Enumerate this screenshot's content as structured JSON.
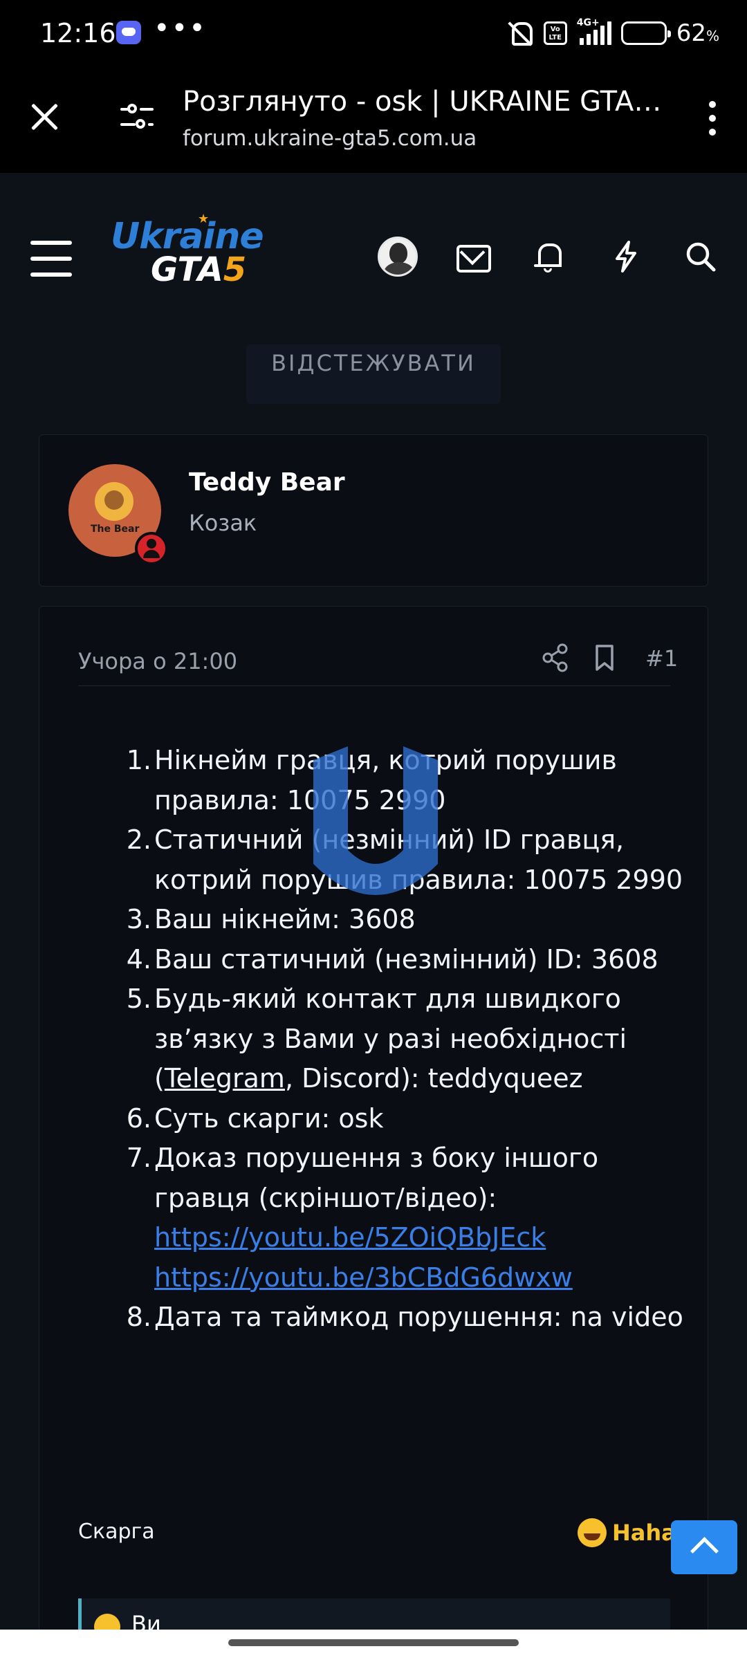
{
  "status_bar": {
    "time": "12:16",
    "overflow": "•••",
    "volte": "Vo\nLTE",
    "network": "4G+",
    "battery_percent": "62",
    "battery_unit": "%",
    "battery_level": 0.62
  },
  "browser": {
    "title": "Розглянуто - osk | UKRAINE GTA 5...",
    "url": "forum.ukraine-gta5.com.ua"
  },
  "site": {
    "logo_line1": "Ukraine",
    "logo_line2": "GTA",
    "logo_five": "5",
    "follow_label": "ВІДСТЕЖУВАТИ"
  },
  "author": {
    "name": "Teddy Bear",
    "rank": "Козак",
    "avatar_text": "The Bear"
  },
  "post": {
    "date": "Учора о 21:00",
    "number": "#1",
    "items": [
      {
        "num": "1.",
        "text": "Нікнейм гравця, котрий порушив правила: 10075 2990"
      },
      {
        "num": "2.",
        "text": "Статичний (незмінний) ID гравця, котрий порушив правила: 10075 2990"
      },
      {
        "num": "3.",
        "text": "Ваш нікнейм: 3608"
      },
      {
        "num": "4.",
        "text": "Ваш статичний (незмінний) ID: 3608"
      },
      {
        "num": "5.",
        "text_before": "Будь-який контакт для швидкого зв’язку з Вами у разі необхідності (",
        "link_word": "Telegram",
        "text_after": ", Discord): teddyqueez"
      },
      {
        "num": "6.",
        "text": "Суть скарги: osk"
      },
      {
        "num": "7.",
        "text": "Доказ порушення з боку іншого гравця (скріншот/відео):",
        "links": [
          "https://youtu.be/5ZOiQBbJEck",
          "https://youtu.be/3bCBdG6dwxw"
        ]
      },
      {
        "num": "8.",
        "text": "Дата та таймкод порушення: na video"
      }
    ],
    "tag": "Скарга",
    "reaction_label": "Haha",
    "quote_text": "Ви"
  },
  "colors": {
    "background": "#0d1118",
    "card": "#0a0e14",
    "link": "#3a7fe8",
    "accent": "#2a8af0",
    "logo_blue": "#2d7fd8",
    "logo_orange": "#f2a51a"
  },
  "icons": [
    "close-icon",
    "tune-icon",
    "menu-dots-icon",
    "hamburger-icon",
    "envelope-icon",
    "bell-icon",
    "bolt-icon",
    "search-icon",
    "share-icon",
    "bookmark-icon",
    "chevron-up-icon"
  ]
}
